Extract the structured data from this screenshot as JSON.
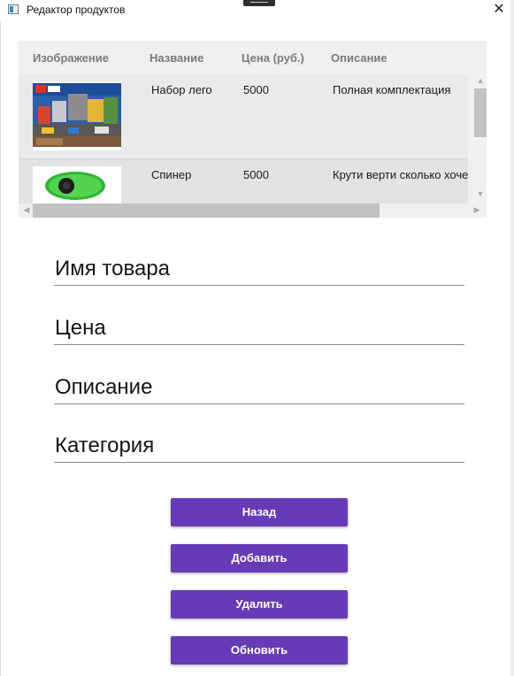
{
  "window": {
    "title": "Редактор продуктов",
    "close_glyph": "✕"
  },
  "table": {
    "columns": [
      "Изображение",
      "Название",
      "Цена (руб.)",
      "Описание"
    ],
    "rows": [
      {
        "image": "lego-city-box",
        "name": "Набор лего",
        "price": "5000",
        "description": "Полная комплектация"
      },
      {
        "image": "green-fidget-spinner",
        "name": "Спинер",
        "price": "5000",
        "description": "Крути верти сколько хочешь"
      }
    ]
  },
  "form": {
    "name_label": "Имя товара",
    "price_label": "Цена",
    "description_label": "Описание",
    "category_label": "Категория"
  },
  "buttons": {
    "back": "Назад",
    "add": "Добавить",
    "delete": "Удалить",
    "update": "Обновить"
  },
  "colors": {
    "accent": "#673ab7",
    "grid_bg": "#f0f0f0"
  }
}
